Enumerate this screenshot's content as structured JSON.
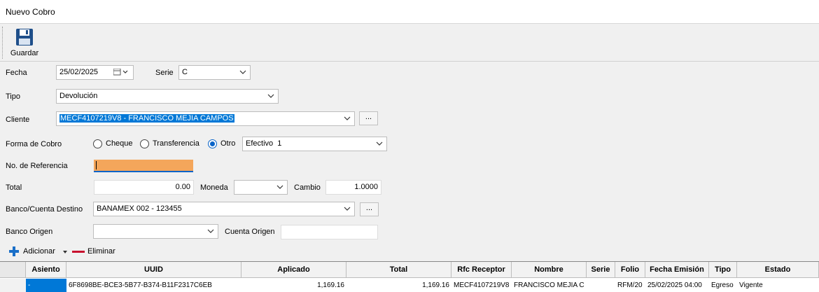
{
  "window": {
    "title": "Nuevo Cobro"
  },
  "toolbar": {
    "save_label": "Guardar"
  },
  "form": {
    "fecha_label": "Fecha",
    "fecha_value": "25/02/2025",
    "serie_label": "Serie",
    "serie_value": "C",
    "tipo_label": "Tipo",
    "tipo_value": "Devolución",
    "cliente_label": "Cliente",
    "cliente_value": "MECF4107219V8 - FRANCISCO MEJIA CAMPOS",
    "cliente_button": "...",
    "forma_label": "Forma de Cobro",
    "forma_options": [
      "Cheque",
      "Transferencia",
      "Otro"
    ],
    "forma_selected": "Otro",
    "forma_otro_value": "Efectivo  1",
    "referencia_label": "No. de Referencia",
    "referencia_value": "",
    "total_label": "Total",
    "total_value": "0.00",
    "moneda_label": "Moneda",
    "moneda_value": "",
    "cambio_label": "Cambio",
    "cambio_value": "1.0000",
    "banco_destino_label": "Banco/Cuenta Destino",
    "banco_destino_value": "BANAMEX 002 - 123455",
    "banco_destino_button": "...",
    "banco_origen_label": "Banco Origen",
    "banco_origen_value": "",
    "cuenta_origen_label": "Cuenta Origen",
    "cuenta_origen_value": ""
  },
  "actions": {
    "add_label": "Adicionar",
    "delete_label": "Eliminar"
  },
  "grid": {
    "headers": [
      "Asiento",
      "UUID",
      "Aplicado",
      "Total",
      "Rfc Receptor",
      "Nombre",
      "Serie",
      "Folio",
      "Fecha Emisión",
      "Tipo",
      "Estado"
    ],
    "rows": [
      {
        "asiento": "-",
        "uuid": "6F8698BE-BCE3-5B77-B374-B11F2317C6EB",
        "aplicado": "1,169.16",
        "total": "1,169.16",
        "rfc": "MECF4107219V8",
        "nombre": "FRANCISCO MEJIA C",
        "serie": "",
        "folio": "RFM/20",
        "fecha": "25/02/2025 04:00",
        "tipo": "Egreso",
        "estado": "Vigente"
      }
    ]
  },
  "colors": {
    "selection": "#0078d7",
    "highlight_field": "#f4a65b",
    "accent_red": "#c8102e",
    "accent_blue": "#1a6fc8"
  }
}
